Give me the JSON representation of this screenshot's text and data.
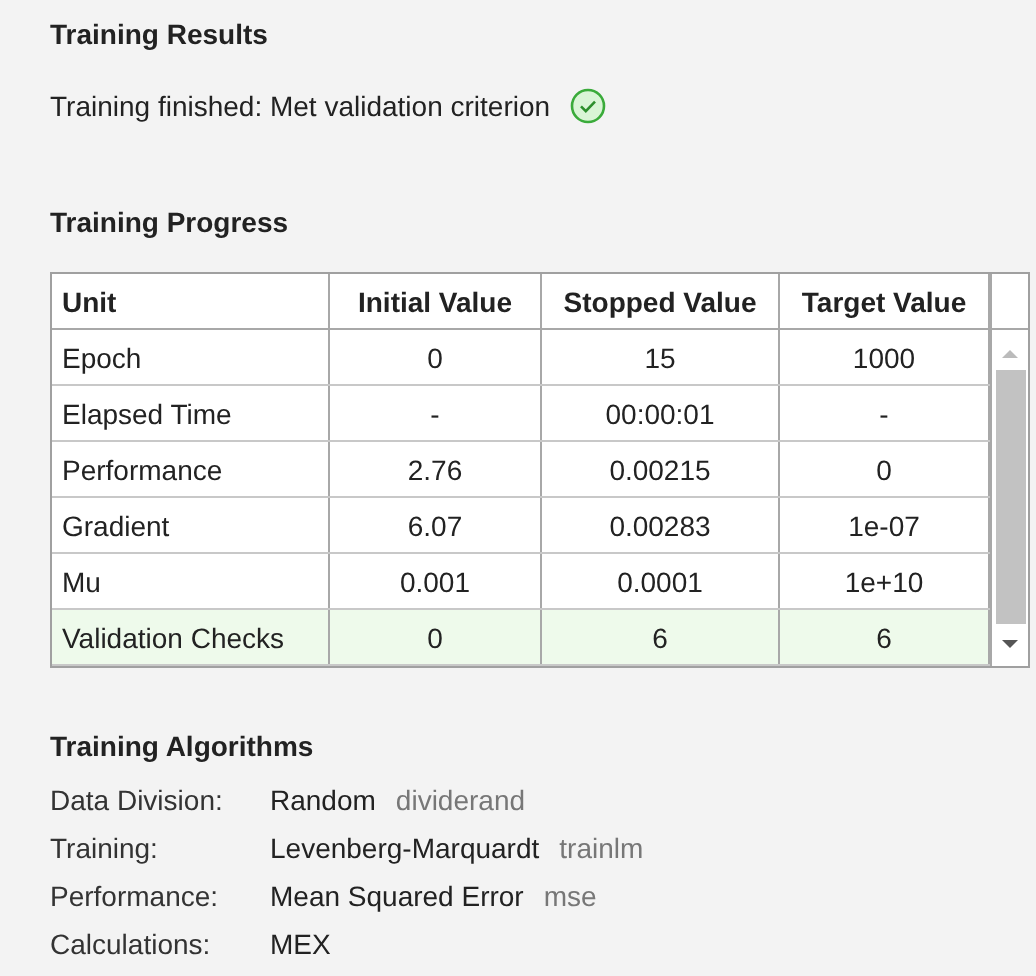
{
  "results": {
    "title": "Training Results",
    "status": "Training finished: Met validation criterion",
    "success": true
  },
  "progress": {
    "title": "Training Progress",
    "columns": [
      "Unit",
      "Initial Value",
      "Stopped Value",
      "Target Value"
    ],
    "rows": [
      {
        "cells": [
          "Epoch",
          "0",
          "15",
          "1000"
        ],
        "highlighted": false
      },
      {
        "cells": [
          "Elapsed Time",
          "-",
          "00:00:01",
          "-"
        ],
        "highlighted": false
      },
      {
        "cells": [
          "Performance",
          "2.76",
          "0.00215",
          "0"
        ],
        "highlighted": false
      },
      {
        "cells": [
          "Gradient",
          "6.07",
          "0.00283",
          "1e-07"
        ],
        "highlighted": false
      },
      {
        "cells": [
          "Mu",
          "0.001",
          "0.0001",
          "1e+10"
        ],
        "highlighted": false
      },
      {
        "cells": [
          "Validation Checks",
          "0",
          "6",
          "6"
        ],
        "highlighted": true
      }
    ]
  },
  "algorithms": {
    "title": "Training Algorithms",
    "items": [
      {
        "label": "Data Division:",
        "value": "Random",
        "function": "dividerand"
      },
      {
        "label": "Training:",
        "value": "Levenberg-Marquardt",
        "function": "trainlm"
      },
      {
        "label": "Performance:",
        "value": "Mean Squared Error",
        "function": "mse"
      },
      {
        "label": "Calculations:",
        "value": "MEX"
      }
    ]
  }
}
